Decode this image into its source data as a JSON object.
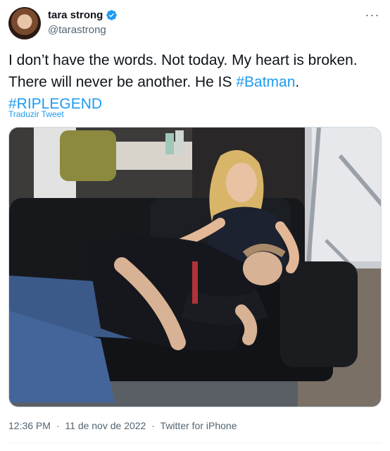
{
  "author": {
    "display_name": "tara strong",
    "handle": "@tarastrong",
    "verified_icon": "verified-badge-icon"
  },
  "tweet": {
    "text_line1": "I don’t have the words. Not today. My heart is broken.",
    "text_line2_plain": "There will never be another. He IS ",
    "hashtag_batman": "#Batman",
    "text_line2_end": ".",
    "hashtag_ripl": "#RIPLEGEND",
    "translate_label": "Traduzir Tweet"
  },
  "media": {
    "description_icon": "photo"
  },
  "meta": {
    "time": "12:36 PM",
    "separator": "·",
    "date": "11 de nov de 2022",
    "source": "Twitter for iPhone"
  },
  "colors": {
    "accent": "#1d9bf0",
    "text": "#0f1419",
    "muted": "#536471"
  }
}
